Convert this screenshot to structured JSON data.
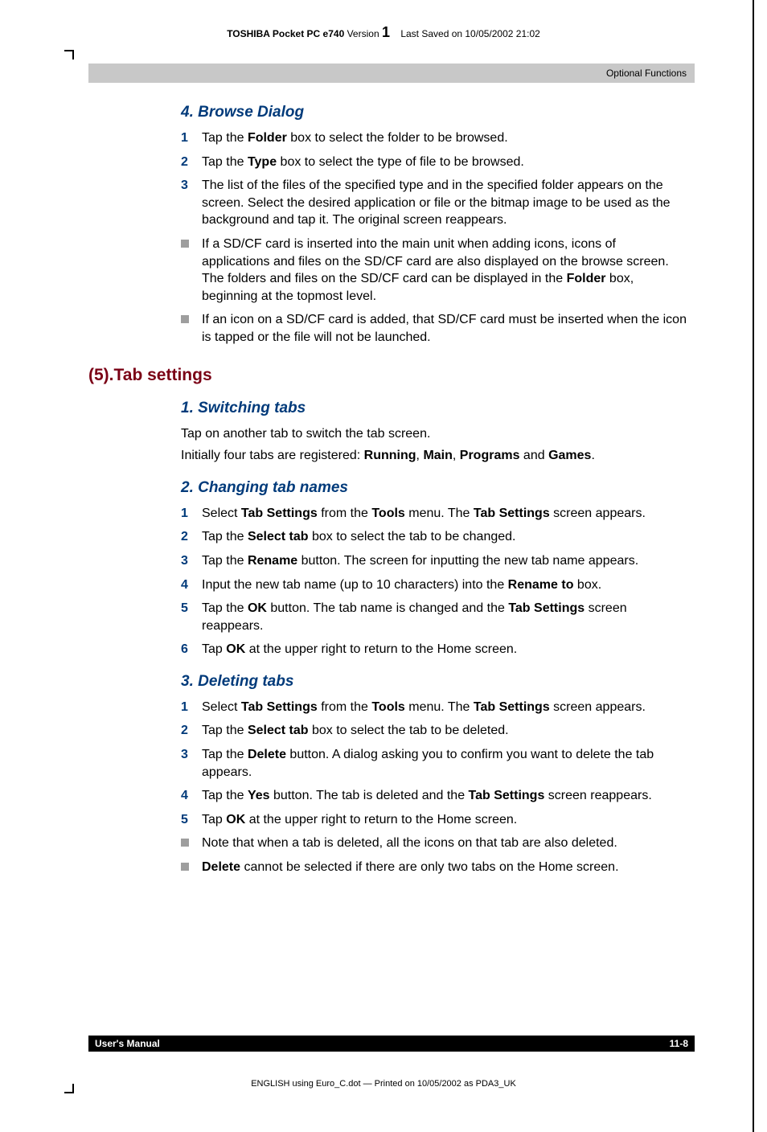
{
  "header": {
    "product": "TOSHIBA Pocket PC e740",
    "version_label": "Version",
    "version_num": "1",
    "saved": "Last Saved on 10/05/2002 21:02"
  },
  "chapter_tag": "Optional Functions",
  "section_browse": {
    "title": "4. Browse Dialog",
    "steps": [
      "Tap the <b>Folder</b> box to select the folder to be browsed.",
      "Tap the <b>Type</b> box to select the type of file to be browsed.",
      "The list of the files of the specified type and in the specified folder appears on the screen. Select the desired application or file or the bitmap image to be used as the background and tap it. The original screen reappears."
    ],
    "notes": [
      "If a SD/CF card is inserted into the main unit when adding icons, icons of applications and files on the SD/CF card are also displayed on the browse screen. The folders and files on the SD/CF card can be displayed in the <b>Folder</b> box, beginning at the topmost level.",
      "If an icon on a SD/CF card is added, that SD/CF card must be inserted when the icon is tapped or the file will not be launched."
    ]
  },
  "h2_tab": "(5).Tab settings",
  "section_switch": {
    "title": "1. Switching tabs",
    "paras": [
      "Tap on another tab to switch the tab screen.",
      "Initially four tabs are registered: <b>Running</b>, <b>Main</b>, <b>Programs</b> and <b>Games</b>."
    ]
  },
  "section_change": {
    "title": "2. Changing tab names",
    "steps": [
      "Select <b>Tab Settings</b> from the <b>Tools</b> menu. The <b>Tab Settings</b> screen appears.",
      "Tap the <b>Select tab</b> box to select the tab to be changed.",
      "Tap the <b>Rename</b> button. The screen for inputting the new tab name appears.",
      "Input the new tab name (up to 10 characters) into the <b>Rename to</b> box.",
      "Tap the <b>OK</b> button. The tab name is changed and the <b>Tab Settings</b> screen reappears.",
      "Tap <b>OK</b> at the upper right to return to the Home screen."
    ]
  },
  "section_delete": {
    "title": "3. Deleting tabs",
    "steps": [
      "Select <b>Tab Settings</b> from the <b>Tools</b> menu. The <b>Tab Settings</b> screen appears.",
      "Tap the <b>Select tab</b> box to select the tab to be deleted.",
      "Tap the <b>Delete</b> button. A dialog asking you to confirm you want to delete the tab appears.",
      "Tap the <b>Yes</b> button. The tab is deleted and the <b>Tab Settings</b> screen reappears.",
      "Tap <b>OK</b> at the upper right to return to the Home screen."
    ],
    "notes": [
      "Note that when a tab is deleted, all the icons on that tab are also deleted.",
      "<b>Delete</b> cannot be selected if there are only two tabs on the Home screen."
    ]
  },
  "footer": {
    "left": "User's Manual",
    "right": "11-8"
  },
  "printline": "ENGLISH using  Euro_C.dot — Printed on 10/05/2002 as PDA3_UK"
}
